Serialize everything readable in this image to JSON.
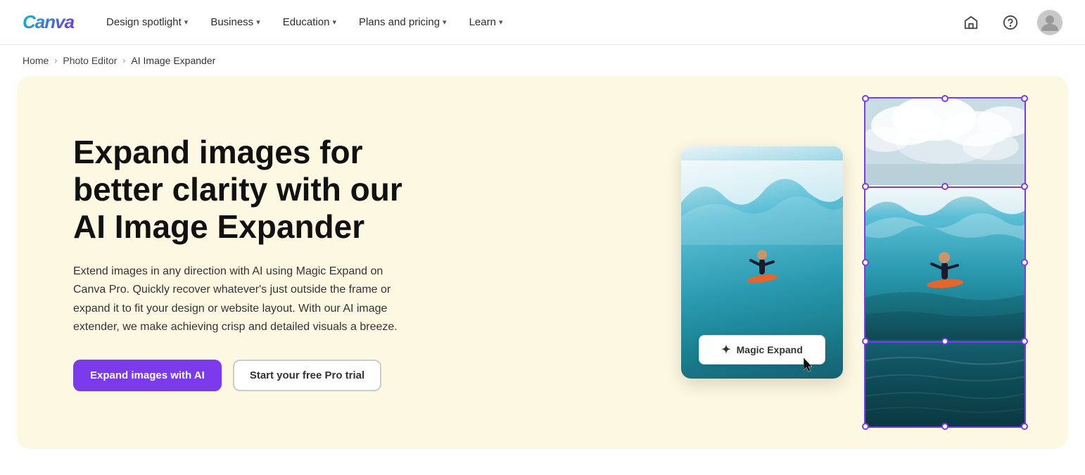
{
  "navbar": {
    "logo": "Canva",
    "nav_items": [
      {
        "label": "Design spotlight",
        "has_chevron": true
      },
      {
        "label": "Business",
        "has_chevron": true
      },
      {
        "label": "Education",
        "has_chevron": true
      },
      {
        "label": "Plans and pricing",
        "has_chevron": true
      },
      {
        "label": "Learn",
        "has_chevron": true
      }
    ],
    "home_icon_title": "Home",
    "help_icon_title": "Help",
    "avatar_title": "User profile"
  },
  "breadcrumb": {
    "items": [
      {
        "label": "Home",
        "link": true
      },
      {
        "label": "Photo Editor",
        "link": true
      },
      {
        "label": "AI Image Expander",
        "link": false
      }
    ]
  },
  "hero": {
    "title": "Expand images for better clarity with our AI Image Expander",
    "description": "Extend images in any direction with AI using Magic Expand on Canva Pro. Quickly recover whatever's just outside the frame or expand it to fit your design or website layout. With our AI image extender, we make achieving crisp and detailed visuals a breeze.",
    "btn_primary": "Expand images with AI",
    "btn_secondary": "Start your free Pro trial",
    "magic_expand_label": "Magic Expand"
  }
}
